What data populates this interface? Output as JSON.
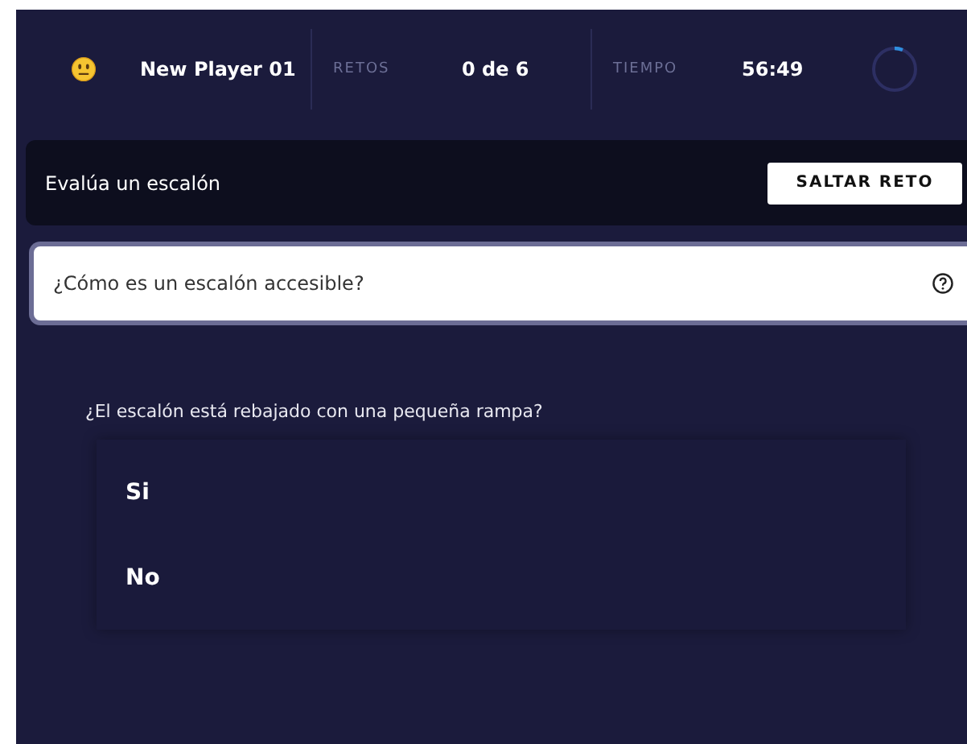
{
  "header": {
    "player": "New Player 01",
    "stats": [
      {
        "label": "RETOS",
        "value": "0 de 6"
      },
      {
        "label": "TIEMPO",
        "value": "56:49"
      }
    ]
  },
  "task": {
    "title": "Evalúa un escalón",
    "button": "SALTAR RETO"
  },
  "hint": {
    "text": "¿Cómo es un escalón accesible?"
  },
  "question": {
    "text": "¿El escalón está rebajado con una pequeña rampa?",
    "options": [
      "Si",
      "No"
    ]
  }
}
